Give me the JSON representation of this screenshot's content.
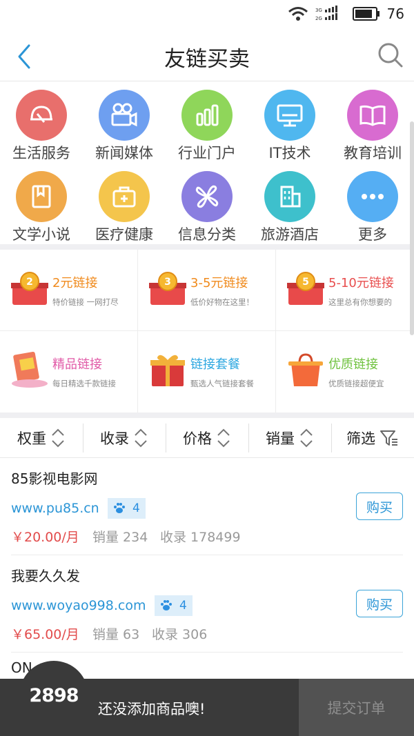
{
  "status_bar": {
    "battery_percent": "76",
    "signal_3g": "3G",
    "signal_2g": "2G"
  },
  "header": {
    "title": "友链买卖"
  },
  "categories": [
    {
      "label": "生活服务",
      "color": "#e86f6c",
      "icon": "helmet-icon"
    },
    {
      "label": "新闻媒体",
      "color": "#6e9ff0",
      "icon": "video-camera-icon"
    },
    {
      "label": "行业门户",
      "color": "#8fd65a",
      "icon": "bar-chart-icon"
    },
    {
      "label": "IT技术",
      "color": "#4fb7ef",
      "icon": "monitor-icon"
    },
    {
      "label": "教育培训",
      "color": "#d86bd0",
      "icon": "book-icon"
    },
    {
      "label": "文学小说",
      "color": "#f0a94a",
      "icon": "notebook-icon"
    },
    {
      "label": "医疗健康",
      "color": "#f4c54c",
      "icon": "medical-kit-icon"
    },
    {
      "label": "信息分类",
      "color": "#8a7ee0",
      "icon": "clover-icon"
    },
    {
      "label": "旅游酒店",
      "color": "#3ec0cc",
      "icon": "building-icon"
    },
    {
      "label": "更多",
      "color": "#55aef3",
      "icon": "more-icon"
    }
  ],
  "promos": [
    {
      "title": "2元链接",
      "subtitle": "特价链接 一网打尽",
      "color": "#f08a1c",
      "badge": "2",
      "icon": "gift-box-icon"
    },
    {
      "title": "3-5元链接",
      "subtitle": "低价好物在这里！",
      "color": "#f08a1c",
      "badge": "3",
      "icon": "gift-box-icon"
    },
    {
      "title": "5-10元链接",
      "subtitle": "这里总有你想要的",
      "color": "#e84e4e",
      "badge": "5",
      "icon": "gift-box-icon"
    },
    {
      "title": "精品链接",
      "subtitle": "每日精选千款链接",
      "color": "#e15aa7",
      "icon": "gift-card-icon"
    },
    {
      "title": "链接套餐",
      "subtitle": "甄选人气链接套餐",
      "color": "#2ca7e0",
      "icon": "present-icon"
    },
    {
      "title": "优质链接",
      "subtitle": "优质链接超便宜",
      "color": "#6fc23e",
      "icon": "shopping-bag-icon"
    }
  ],
  "sort_bar": [
    {
      "label": "权重",
      "icon": "sort-updown-icon"
    },
    {
      "label": "收录",
      "icon": "sort-updown-icon"
    },
    {
      "label": "价格",
      "icon": "sort-updown-icon"
    },
    {
      "label": "销量",
      "icon": "sort-updown-icon"
    },
    {
      "label": "筛选",
      "icon": "filter-icon"
    }
  ],
  "listings": [
    {
      "name": "85影视电影网",
      "url": "www.pu85.cn",
      "weight": "4",
      "price": "￥20.00/月",
      "sales": "销量 234",
      "indexed": "收录 178499",
      "buy_label": "购买"
    },
    {
      "name": "我要久久发",
      "url": "www.woyao998.com",
      "weight": "4",
      "price": "￥65.00/月",
      "sales": "销量 63",
      "indexed": "收录 306",
      "buy_label": "购买"
    }
  ],
  "partial_next": "ON",
  "bottom_bar": {
    "logo": "2898",
    "empty_message": "还没添加商品噢!",
    "submit_label": "提交订单"
  }
}
